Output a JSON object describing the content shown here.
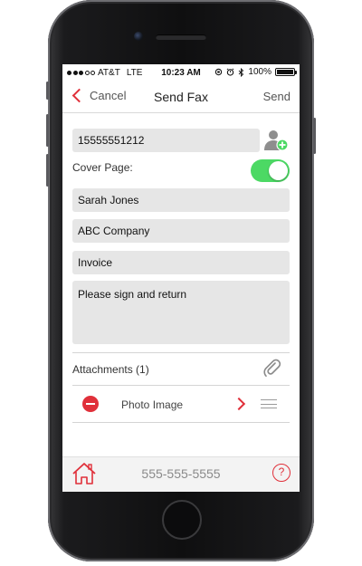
{
  "statusbar": {
    "carrier": "AT&T",
    "network": "LTE",
    "time": "10:23 AM",
    "battery": "100%",
    "signal_bars": 3
  },
  "navbar": {
    "cancel_label": "Cancel",
    "title": "Send Fax",
    "send_label": "Send"
  },
  "form": {
    "fax_number": "15555551212",
    "cover_page_label": "Cover Page:",
    "cover_page_enabled": true,
    "recipient_name": "Sarah Jones",
    "company": "ABC Company",
    "subject": "Invoice",
    "message": "Please sign and return"
  },
  "attachments": {
    "label": "Attachments (1)",
    "items": [
      {
        "name": "Photo Image"
      }
    ]
  },
  "footer": {
    "phone_number": "555-555-5555",
    "help_glyph": "?"
  },
  "colors": {
    "accent": "#e0303a",
    "toggle_on": "#4cd964",
    "field_bg": "#e6e6e6"
  },
  "icons": {
    "add_contact": "add-contact-icon",
    "paperclip": "paperclip-icon",
    "home": "home-icon",
    "help": "help-icon"
  }
}
